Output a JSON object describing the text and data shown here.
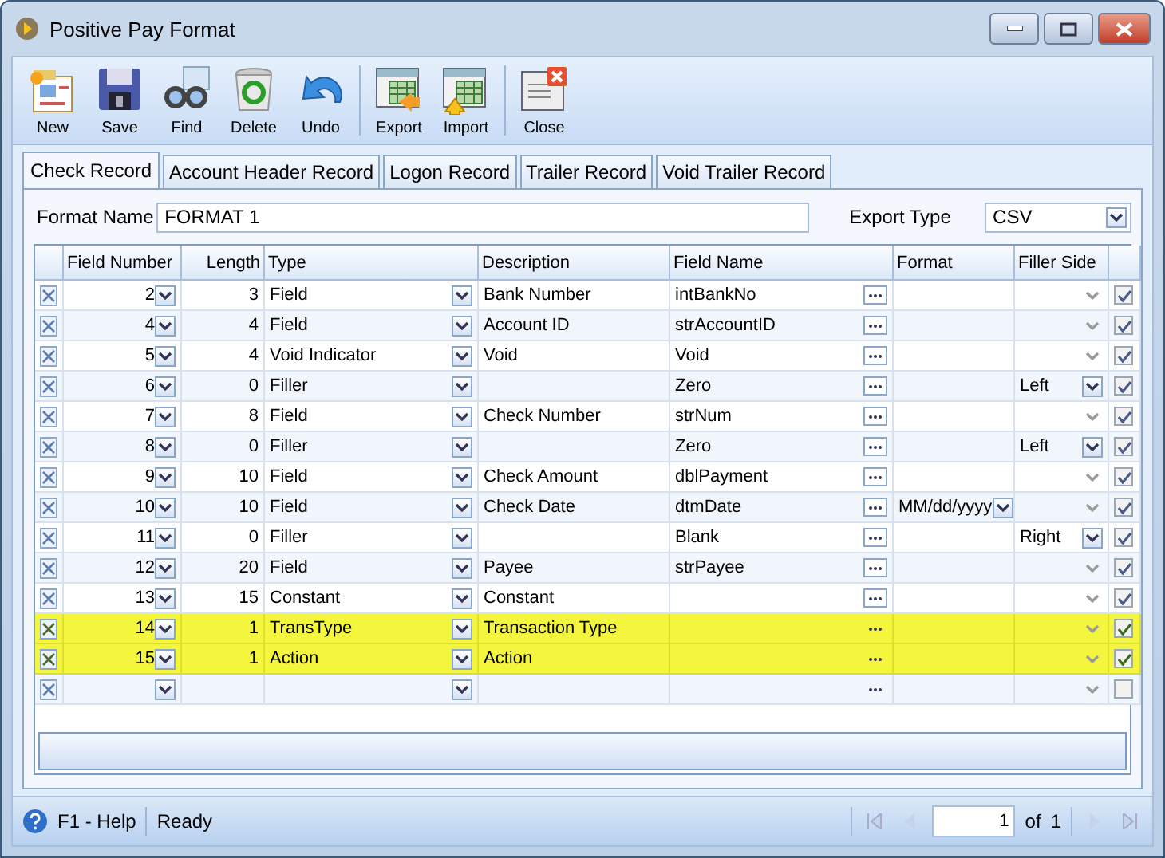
{
  "window": {
    "title": "Positive Pay Format"
  },
  "toolbar_groups": [
    {
      "buttons": [
        {
          "label": "New",
          "kind": "new"
        },
        {
          "label": "Save",
          "kind": "save"
        },
        {
          "label": "Find",
          "kind": "find"
        },
        {
          "label": "Delete",
          "kind": "delete"
        },
        {
          "label": "Undo",
          "kind": "undo"
        }
      ]
    },
    {
      "buttons": [
        {
          "label": "Export",
          "kind": "export"
        },
        {
          "label": "Import",
          "kind": "import"
        }
      ]
    },
    {
      "buttons": [
        {
          "label": "Close",
          "kind": "close"
        }
      ]
    }
  ],
  "tabs": [
    {
      "label": "Check Record",
      "selected": true
    },
    {
      "label": "Account Header Record",
      "selected": false
    },
    {
      "label": "Logon Record",
      "selected": false
    },
    {
      "label": "Trailer Record",
      "selected": false
    },
    {
      "label": "Void Trailer Record",
      "selected": false
    }
  ],
  "format_name": {
    "label": "Format Name",
    "value": "FORMAT 1"
  },
  "export_type": {
    "label": "Export Type",
    "value": "CSV"
  },
  "table": {
    "columns": [
      "Field Number",
      "Length",
      "Type",
      "Description",
      "Field Name",
      "Format",
      "Filler Side"
    ],
    "rows": [
      {
        "kind": "record",
        "selected": false,
        "field_number": "2",
        "length": "3",
        "type": "Field",
        "description": "Bank Number",
        "field_name": "intBankNo",
        "format": "",
        "filler_side": "",
        "checked": true
      },
      {
        "kind": "record",
        "selected": false,
        "field_number": "4",
        "length": "4",
        "type": "Field",
        "description": "Account ID",
        "field_name": "strAccountID",
        "format": "",
        "filler_side": "",
        "checked": true
      },
      {
        "kind": "record",
        "selected": false,
        "field_number": "5",
        "length": "4",
        "type": "Void Indicator",
        "description": "Void",
        "field_name": "Void",
        "format": "",
        "filler_side": "",
        "checked": true
      },
      {
        "kind": "record",
        "selected": false,
        "field_number": "6",
        "length": "0",
        "type": "Filler",
        "description": "",
        "field_name": "Zero",
        "format": "",
        "filler_side": "Left",
        "checked": true
      },
      {
        "kind": "record",
        "selected": false,
        "field_number": "7",
        "length": "8",
        "type": "Field",
        "description": "Check Number",
        "field_name": "strNum",
        "format": "",
        "filler_side": "",
        "checked": true
      },
      {
        "kind": "record",
        "selected": false,
        "field_number": "8",
        "length": "0",
        "type": "Filler",
        "description": "",
        "field_name": "Zero",
        "format": "",
        "filler_side": "Left",
        "checked": true
      },
      {
        "kind": "record",
        "selected": false,
        "field_number": "9",
        "length": "10",
        "type": "Field",
        "description": "Check Amount",
        "field_name": "dblPayment",
        "format": "",
        "filler_side": "",
        "checked": true
      },
      {
        "kind": "record",
        "selected": false,
        "field_number": "10",
        "length": "10",
        "type": "Field",
        "description": "Check Date",
        "field_name": "dtmDate",
        "format": "MM/dd/yyyy",
        "filler_side": "",
        "checked": true
      },
      {
        "kind": "record",
        "selected": false,
        "field_number": "11",
        "length": "0",
        "type": "Filler",
        "description": "",
        "field_name": "Blank",
        "format": "",
        "filler_side": "Right",
        "checked": true
      },
      {
        "kind": "record",
        "selected": false,
        "field_number": "12",
        "length": "20",
        "type": "Field",
        "description": "Payee",
        "field_name": "strPayee",
        "format": "",
        "filler_side": "",
        "checked": true
      },
      {
        "kind": "record",
        "selected": false,
        "field_number": "13",
        "length": "15",
        "type": "Constant",
        "description": "Constant",
        "field_name": "",
        "format": "",
        "filler_side": "",
        "checked": true
      },
      {
        "kind": "record",
        "selected": true,
        "field_number": "14",
        "length": "1",
        "type": "TransType",
        "description": "Transaction Type",
        "field_name": "",
        "format": "",
        "filler_side": "",
        "checked": true
      },
      {
        "kind": "record",
        "selected": true,
        "field_number": "15",
        "length": "1",
        "type": "Action",
        "description": "Action",
        "field_name": "",
        "format": "",
        "filler_side": "",
        "checked": true
      },
      {
        "kind": "new",
        "selected": false,
        "field_number": "",
        "length": "",
        "type": "",
        "description": "",
        "field_name": "",
        "format": "",
        "filler_side": "",
        "checked": false
      }
    ]
  },
  "status_bar": {
    "help": "F1 - Help",
    "status": "Ready",
    "page": "1",
    "of_label": "of",
    "total": "1"
  }
}
